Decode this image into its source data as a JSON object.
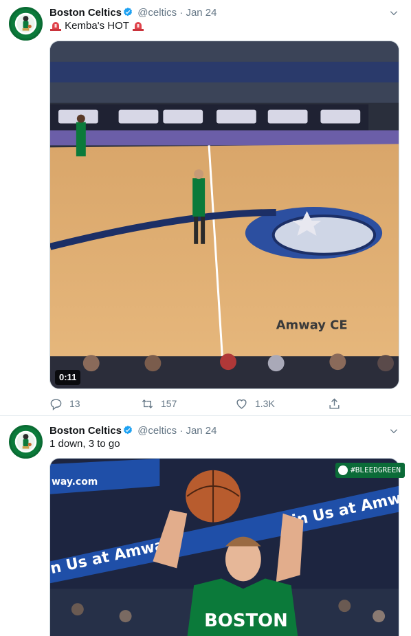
{
  "tweets": [
    {
      "author_name": "Boston Celtics",
      "handle": "@celtics",
      "separator": "·",
      "date": "Jan 24",
      "text": "Kemba's HOT",
      "video_duration": "0:11",
      "court_text": "Amway CE",
      "actions": {
        "replies": "13",
        "retweets": "157",
        "likes": "1.3K"
      }
    },
    {
      "author_name": "Boston Celtics",
      "handle": "@celtics",
      "separator": "·",
      "date": "Jan 24",
      "text": "1 down, 3 to go",
      "hashtag": "#BLEEDGREEN",
      "arena_banner_left": "way.com",
      "arena_banner_top": "in Us at Amway",
      "arena_banner_bottom": "n Us at Amway.",
      "jersey_text": "BOSTON"
    }
  ],
  "colors": {
    "celtics_green": "#0b7a3a",
    "verified_blue": "#1da1f2",
    "muted": "#657786"
  },
  "icons": [
    "verified-badge-icon",
    "caret-down-icon",
    "siren-icon",
    "reply-icon",
    "retweet-icon",
    "like-icon",
    "share-icon"
  ]
}
